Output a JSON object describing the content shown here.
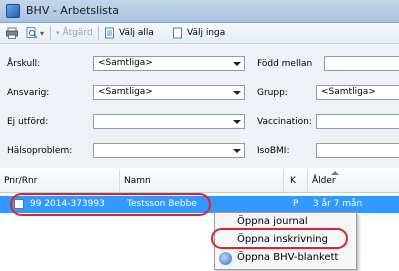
{
  "window": {
    "title": "BHV - Arbetslista"
  },
  "toolbar": {
    "action_label": "Åtgärd",
    "select_all_label": "Välj alla",
    "select_none_label": "Välj inga"
  },
  "filters": {
    "arskull": {
      "label": "Årskull:",
      "value": "<Samtliga>"
    },
    "ansvarig": {
      "label": "Ansvarig:",
      "value": "<Samtliga>"
    },
    "ej_utford": {
      "label": "Ej utförd:",
      "value": ""
    },
    "halsoproblem": {
      "label": "Hälsoproblem:",
      "value": ""
    },
    "fodd_mellan": {
      "label": "Född mellan",
      "value": ""
    },
    "grupp": {
      "label": "Grupp:",
      "value": "<Samtliga>"
    },
    "vaccination": {
      "label": "Vaccination:",
      "value": ""
    },
    "isobmi": {
      "label": "IsoBMI:",
      "value": ""
    }
  },
  "grid": {
    "columns": [
      "Pnr/Rnr",
      "Namn",
      "K",
      "Ålder"
    ],
    "rows": [
      {
        "pnr": "99  2014-373993",
        "namn": "Testsson Bebbe",
        "k": "P",
        "alder": "3 år 7 mån",
        "selected": true
      }
    ]
  },
  "context_menu": {
    "items": [
      {
        "label": "Öppna journal"
      },
      {
        "label": "Öppna inskrivning"
      },
      {
        "label": "Öppna BHV-blankett"
      }
    ]
  },
  "colors": {
    "selection": "#3399ff",
    "highlight_ring": "#e0232b",
    "titlebar": "#b7cde6"
  }
}
